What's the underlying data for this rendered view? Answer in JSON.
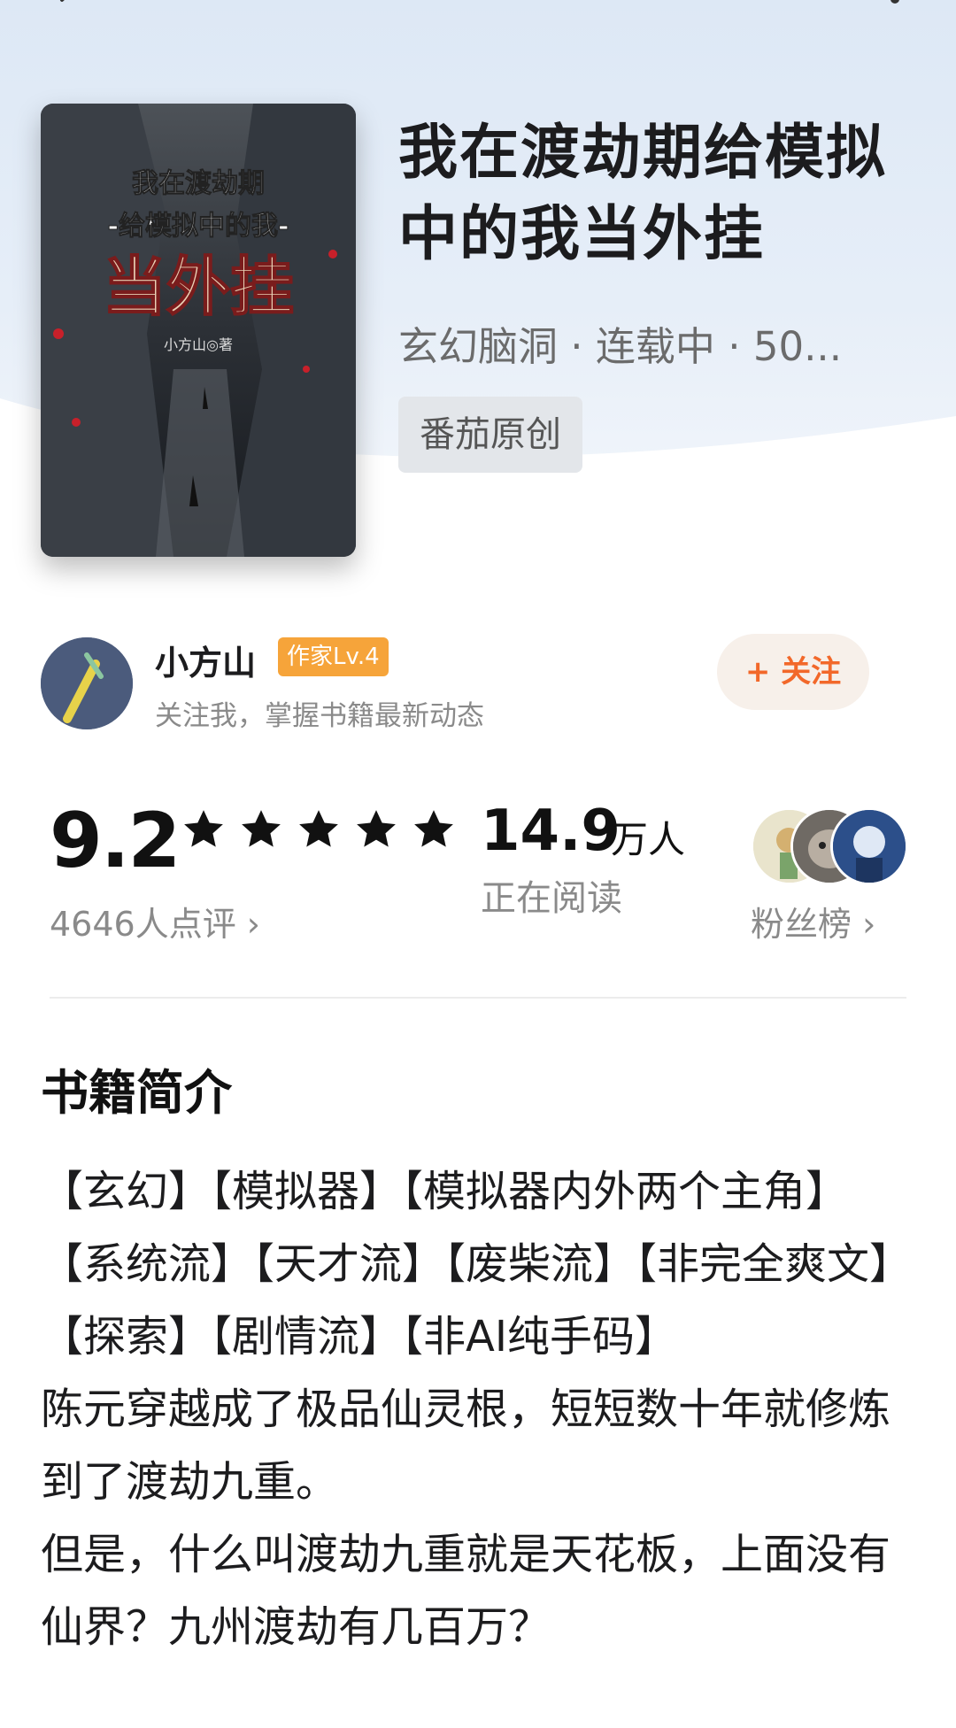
{
  "book": {
    "title": "我在渡劫期给模拟中的我当外挂",
    "meta": "玄幻脑洞 · 连载中 · 50...",
    "source_tag": "番茄原创",
    "cover": {
      "title_line1": "我在渡劫期",
      "title_line2": "-给模拟中的我-",
      "title_big": "当外挂",
      "author_mark": "小方山◎著"
    }
  },
  "author": {
    "name": "小方山",
    "level": "作家Lv.4",
    "subtitle": "关注我，掌握书籍最新动态",
    "follow_label": "+ 关注"
  },
  "stats": {
    "score": "9.2",
    "stars": 5,
    "reviews": "4646人点评 ›",
    "readers_num": "14.9",
    "readers_unit": "万人",
    "readers_label": "正在阅读",
    "fans_label": "粉丝榜 ›"
  },
  "intro": {
    "title": "书籍简介",
    "paragraphs": [
      "【玄幻】【模拟器】【模拟器内外两个主角】【系统流】【天才流】【废柴流】【非完全爽文】【探索】【剧情流】【非AI纯手码】",
      "陈元穿越成了极品仙灵根，短短数十年就修炼到了渡劫九重。",
      "但是，什么叫渡劫九重就是天花板，上面没有仙界？九州渡劫有几百万？"
    ]
  },
  "colors": {
    "accent": "#f2682a",
    "level_badge": "#f6a43a",
    "star": "#111111"
  }
}
